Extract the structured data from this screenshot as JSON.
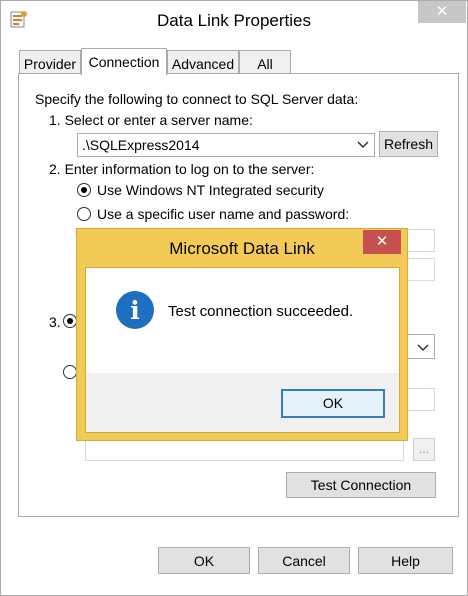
{
  "window": {
    "title": "Data Link Properties",
    "close_glyph": "✕"
  },
  "tabs": [
    {
      "label": "Provider",
      "active": false
    },
    {
      "label": "Connection",
      "active": true
    },
    {
      "label": "Advanced",
      "active": false
    },
    {
      "label": "All",
      "active": false
    }
  ],
  "connection": {
    "intro": "Specify the following to connect to SQL Server data:",
    "step1": "1. Select or enter a server name:",
    "server_value": ".\\SQLExpress2014",
    "refresh_label": "Refresh",
    "step2": "2. Enter information to log on to the server:",
    "radio_nt": "Use Windows NT Integrated security",
    "radio_specific": "Use a specific user name and password:",
    "step3_number": "3.",
    "browse_label": "...",
    "test_connection_label": "Test Connection"
  },
  "footer": {
    "ok": "OK",
    "cancel": "Cancel",
    "help": "Help"
  },
  "dialog": {
    "title": "Microsoft Data Link",
    "close_glyph": "✕",
    "message": "Test connection succeeded.",
    "icon_glyph": "i",
    "ok": "OK",
    "colors": {
      "frame": "#f2cb57",
      "close": "#c75050",
      "info_icon": "#1f6fc1"
    }
  }
}
